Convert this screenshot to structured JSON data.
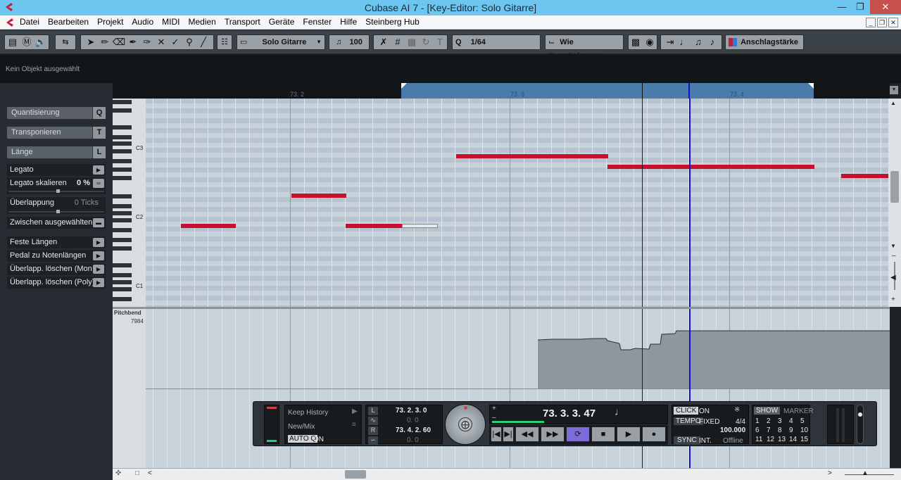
{
  "window": {
    "title": "Cubase AI 7 - [Key-Editor: Solo Gitarre]"
  },
  "menu": [
    "Datei",
    "Bearbeiten",
    "Projekt",
    "Audio",
    "MIDI",
    "Medien",
    "Transport",
    "Geräte",
    "Fenster",
    "Hilfe",
    "Steinberg Hub"
  ],
  "toolbar": {
    "track": "Solo Gitarre",
    "velocity": "100",
    "quantize_value": "1/64",
    "length_quantize": "Wie Quantisierung",
    "controller_lane": "Anschlagstärke"
  },
  "infoline": {
    "text": "Kein Objekt ausgewählt"
  },
  "ruler": {
    "labels": [
      "73. 2",
      "73. 3",
      "73. 4"
    ]
  },
  "inspector": {
    "sections": [
      {
        "label": "Quantisierung",
        "key": "Q"
      },
      {
        "label": "Transponieren",
        "key": "T"
      },
      {
        "label": "Länge",
        "key": "L"
      }
    ],
    "legato": "Legato",
    "legato_scale_label": "Legato skalieren",
    "legato_scale_value": "0 %",
    "overlap_label": "Überlappung",
    "overlap_value": "0 Ticks",
    "between_selected": "Zwischen ausgewählten",
    "actions": [
      "Feste Längen",
      "Pedal zu Notenlängen",
      "Überlapp. löschen (Mon",
      "Überlapp. löschen (Poly)"
    ]
  },
  "keyboard": {
    "labels": [
      "C3",
      "C2",
      "C1"
    ]
  },
  "controller": {
    "name": "Pitchbend",
    "max_value": "7984"
  },
  "transport": {
    "history_label": "Keep History",
    "mix_label": "New/Mix",
    "autoq_label": "AUTO Q",
    "autoq_state": "ON",
    "left_locator": "73. 2. 3.   0",
    "left_locator_sub": "0.   0",
    "right_locator": "73. 4. 2. 60",
    "right_locator_sub": "0.   0",
    "position": "73. 3. 3. 47",
    "click_label": "CLICK",
    "click_state": "ON",
    "tempo_label": "TEMPO",
    "tempo_mode": "FIXED",
    "signature": "4/4",
    "tempo_value": "100.000",
    "sync_label": "SYNC",
    "sync_source": "INT.",
    "sync_state": "Offline",
    "show_label": "SHOW",
    "marker_label": "MARKER",
    "markers": [
      "1",
      "2",
      "3",
      "4",
      "5",
      "6",
      "7",
      "8",
      "9",
      "10",
      "11",
      "12",
      "13",
      "14",
      "15"
    ]
  },
  "colors": {
    "note": "#c8102e",
    "cursor": "#1010d0",
    "accent": "#6dc6ef"
  }
}
